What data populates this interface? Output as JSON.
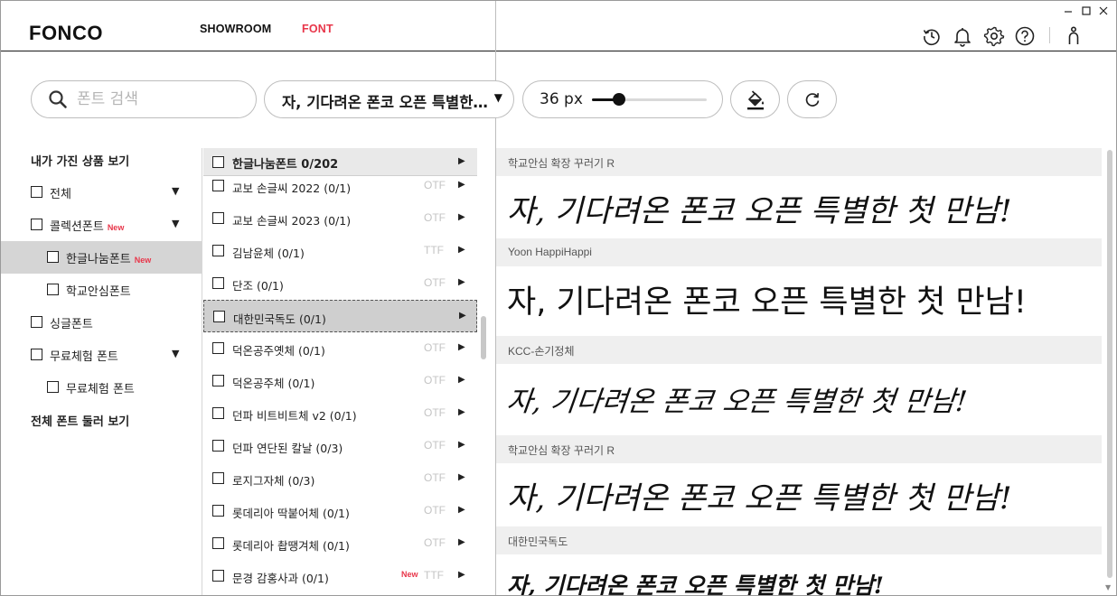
{
  "app": {
    "logo": "FONCO"
  },
  "nav": {
    "showroom": "SHOWROOM",
    "font": "FONT"
  },
  "window_controls": [
    "minimize-icon",
    "maximize-icon",
    "close-icon"
  ],
  "header_icons": [
    "history-icon",
    "bell-icon",
    "gear-icon",
    "help-icon",
    "user-icon"
  ],
  "colors": {
    "accent": "#e8364a",
    "selected_bg": "#d5d5d5",
    "label_bg": "#efefef"
  },
  "toolbar": {
    "search_placeholder": "폰트 검색",
    "sample_text": "자, 기다려온 폰코 오픈 특별한…",
    "sample_caret": "▼",
    "size_label": "36 px",
    "size_slider_fraction": 0.24
  },
  "categories": [
    {
      "label": "내가 가진 상품 보기",
      "type": "heading"
    },
    {
      "label": "전체",
      "checkbox": true,
      "arrow": "▼"
    },
    {
      "label": "콜렉션폰트",
      "checkbox": true,
      "badge": "New",
      "arrow": "▼"
    },
    {
      "label": "한글나눔폰트",
      "checkbox": true,
      "badge": "New",
      "indent": true,
      "selected": true
    },
    {
      "label": "학교안심폰트",
      "checkbox": true,
      "indent": true
    },
    {
      "label": "싱글폰트",
      "checkbox": true
    },
    {
      "label": "무료체험 폰트",
      "checkbox": true,
      "arrow": "▼"
    },
    {
      "label": "무료체험 폰트",
      "checkbox": true,
      "indent": true
    },
    {
      "label": "전체 폰트 둘러 보기",
      "type": "heading"
    }
  ],
  "font_list": {
    "header": "한글나눔폰트 0/202",
    "header_arrow": "▶",
    "items": [
      {
        "name": "교보 손글씨 2022 (0/1)",
        "format": "OTF"
      },
      {
        "name": "교보 손글씨 2023 (0/1)",
        "format": "OTF"
      },
      {
        "name": "김남윤체 (0/1)",
        "format": "TTF"
      },
      {
        "name": "단조 (0/1)",
        "format": "OTF"
      },
      {
        "name": "대한민국독도 (0/1)",
        "format": "",
        "selected": true
      },
      {
        "name": "덕온공주옛체 (0/1)",
        "format": "OTF"
      },
      {
        "name": "덕온공주체 (0/1)",
        "format": "OTF"
      },
      {
        "name": "던파 비트비트체 v2 (0/1)",
        "format": "OTF"
      },
      {
        "name": "던파 연단된 칼날 (0/3)",
        "format": "OTF"
      },
      {
        "name": "로지그자체 (0/3)",
        "format": "OTF"
      },
      {
        "name": "롯데리아 딱붙어체 (0/1)",
        "format": "OTF"
      },
      {
        "name": "롯데리아 촵땡겨체 (0/1)",
        "format": "OTF"
      },
      {
        "name": "문경 감홍사과 (0/1)",
        "format": "TTF",
        "badge": "New"
      }
    ],
    "arrow": "▶"
  },
  "preview": {
    "sample": "자, 기다려온 폰코 오픈 특별한 첫 만남!",
    "items": [
      {
        "font_name": "학교안심 확장 꾸러기 R"
      },
      {
        "font_name": "Yoon HappiHappi"
      },
      {
        "font_name": "KCC-손기정체"
      },
      {
        "font_name": "학교안심 확장 꾸러기 R"
      },
      {
        "font_name": "대한민국독도"
      }
    ]
  }
}
